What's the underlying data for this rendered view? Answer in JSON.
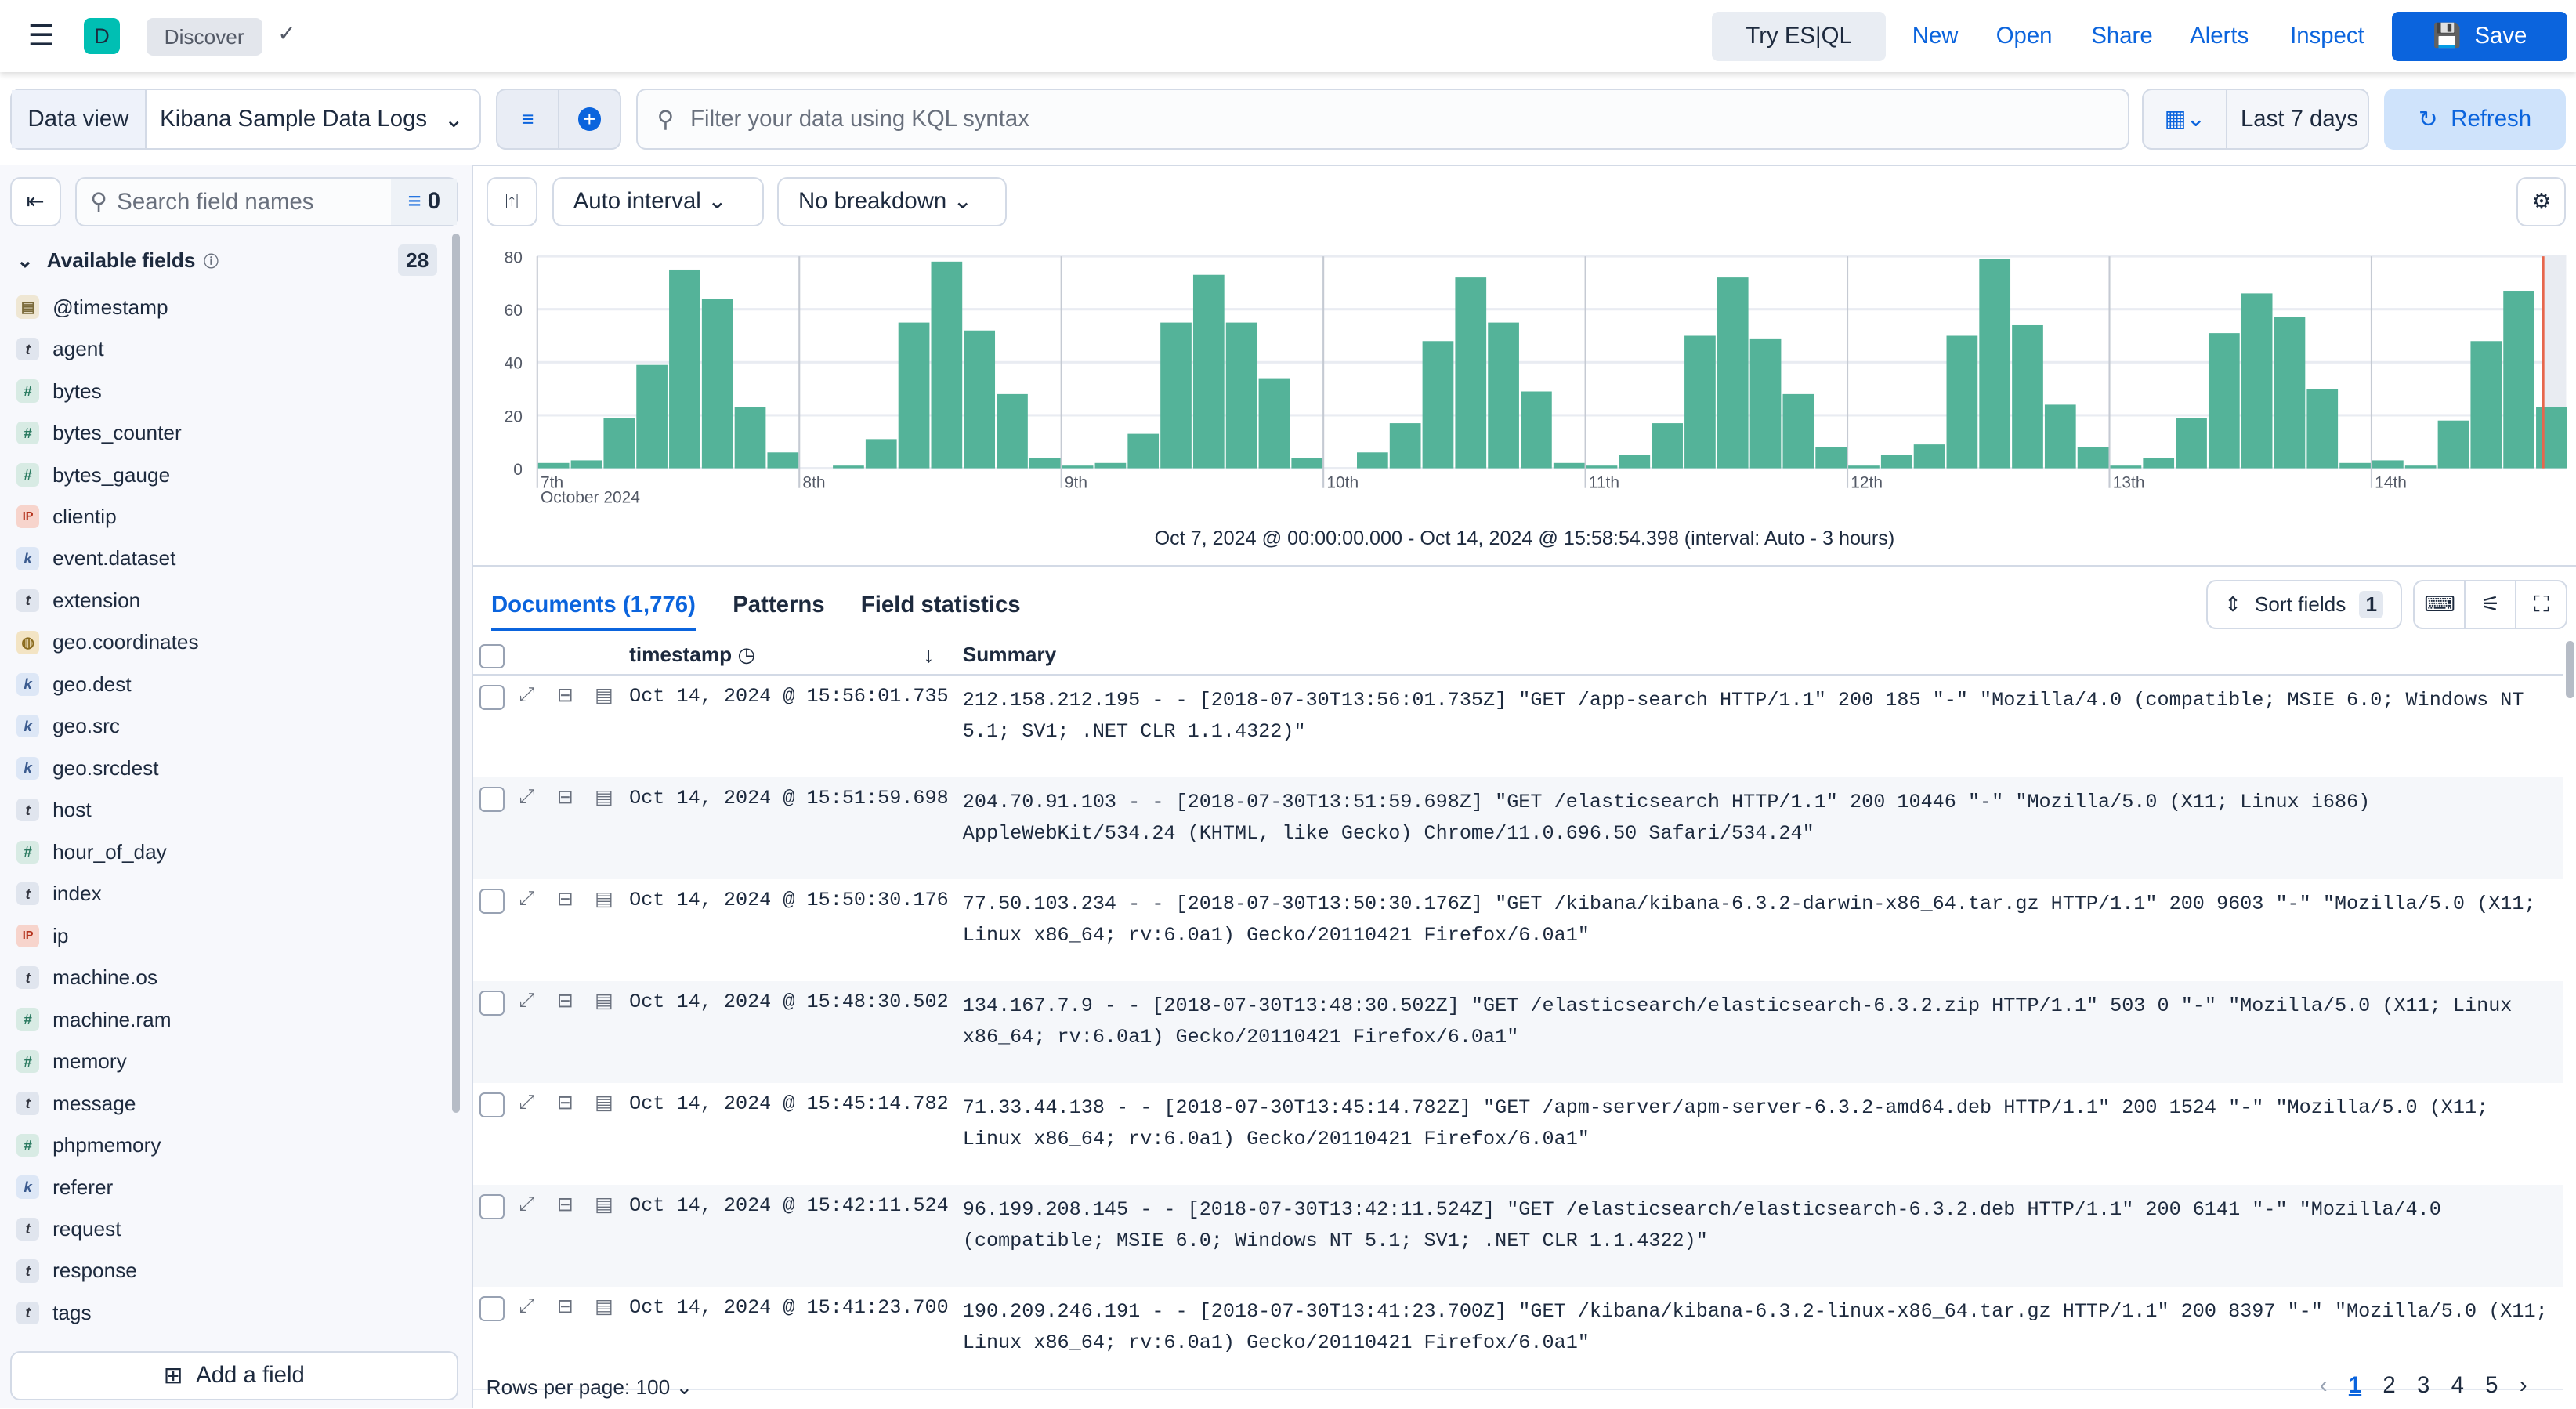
{
  "header": {
    "app_initial": "D",
    "breadcrumb": "Discover",
    "links": [
      "Try ES|QL",
      "New",
      "Open",
      "Share",
      "Alerts",
      "Inspect"
    ],
    "save": "Save",
    "accent": "#0b64dd",
    "app_color": "#00bfb3"
  },
  "query": {
    "data_view_label": "Data view",
    "data_view": "Kibana Sample Data Logs",
    "placeholder": "Filter your data using KQL syntax",
    "time": "Last 7 days",
    "refresh": "Refresh"
  },
  "sidebar": {
    "search_placeholder": "Search field names",
    "filter_count": "0",
    "available_label": "Available fields",
    "available_count": "28",
    "add_field": "Add a field",
    "fields": [
      {
        "name": "@timestamp",
        "type": "date"
      },
      {
        "name": "agent",
        "type": "t"
      },
      {
        "name": "bytes",
        "type": "#"
      },
      {
        "name": "bytes_counter",
        "type": "#"
      },
      {
        "name": "bytes_gauge",
        "type": "#"
      },
      {
        "name": "clientip",
        "type": "IP"
      },
      {
        "name": "event.dataset",
        "type": "k"
      },
      {
        "name": "extension",
        "type": "t"
      },
      {
        "name": "geo.coordinates",
        "type": "geo"
      },
      {
        "name": "geo.dest",
        "type": "k"
      },
      {
        "name": "geo.src",
        "type": "k"
      },
      {
        "name": "geo.srcdest",
        "type": "k"
      },
      {
        "name": "host",
        "type": "t"
      },
      {
        "name": "hour_of_day",
        "type": "#"
      },
      {
        "name": "index",
        "type": "t"
      },
      {
        "name": "ip",
        "type": "IP"
      },
      {
        "name": "machine.os",
        "type": "t"
      },
      {
        "name": "machine.ram",
        "type": "#"
      },
      {
        "name": "memory",
        "type": "#"
      },
      {
        "name": "message",
        "type": "t"
      },
      {
        "name": "phpmemory",
        "type": "#"
      },
      {
        "name": "referer",
        "type": "k"
      },
      {
        "name": "request",
        "type": "t"
      },
      {
        "name": "response",
        "type": "t"
      },
      {
        "name": "tags",
        "type": "t"
      }
    ]
  },
  "chart_toolbar": {
    "interval": "Auto interval",
    "breakdown": "No breakdown"
  },
  "chart_data": {
    "type": "bar",
    "ylim": [
      0,
      80
    ],
    "yticks": [
      "0",
      "20",
      "40",
      "60",
      "80"
    ],
    "xticks": [
      "7th",
      "8th",
      "9th",
      "10th",
      "11th",
      "12th",
      "13th",
      "14th"
    ],
    "x_sublabel": "October 2024",
    "bar_color": "#54b399",
    "now_color": "#e7664c",
    "grid": true,
    "values": [
      2,
      3,
      19,
      39,
      75,
      64,
      23,
      6,
      0,
      1,
      11,
      55,
      78,
      52,
      28,
      4,
      1,
      2,
      13,
      55,
      73,
      55,
      34,
      4,
      0,
      6,
      17,
      48,
      72,
      55,
      29,
      2,
      1,
      5,
      17,
      50,
      72,
      49,
      28,
      8,
      1,
      5,
      9,
      50,
      79,
      54,
      24,
      8,
      1,
      4,
      19,
      51,
      66,
      57,
      30,
      2,
      3,
      1,
      18,
      48,
      67,
      23
    ],
    "caption": "Oct 7, 2024 @ 00:00:00.000 - Oct 14, 2024 @ 15:58:54.398 (interval: Auto - 3 hours)"
  },
  "tabs": [
    "Documents (1,776)",
    "Patterns",
    "Field statistics"
  ],
  "table": {
    "sort_fields": "Sort fields",
    "sort_count": "1",
    "col_timestamp": "timestamp",
    "col_summary": "Summary",
    "rows": [
      {
        "ts": "Oct 14, 2024 @ 15:56:01.735",
        "summary": "212.158.212.195 - - [2018-07-30T13:56:01.735Z] \"GET /app-search HTTP/1.1\" 200 185 \"-\" \"Mozilla/4.0 (compatible; MSIE 6.0; Windows NT 5.1; SV1; .NET CLR 1.1.4322)\""
      },
      {
        "ts": "Oct 14, 2024 @ 15:51:59.698",
        "summary": "204.70.91.103 - - [2018-07-30T13:51:59.698Z] \"GET /elasticsearch HTTP/1.1\" 200 10446 \"-\" \"Mozilla/5.0 (X11; Linux i686) AppleWebKit/534.24 (KHTML, like Gecko) Chrome/11.0.696.50 Safari/534.24\""
      },
      {
        "ts": "Oct 14, 2024 @ 15:50:30.176",
        "summary": "77.50.103.234 - - [2018-07-30T13:50:30.176Z] \"GET /kibana/kibana-6.3.2-darwin-x86_64.tar.gz HTTP/1.1\" 200 9603 \"-\" \"Mozilla/5.0 (X11; Linux x86_64; rv:6.0a1) Gecko/20110421 Firefox/6.0a1\""
      },
      {
        "ts": "Oct 14, 2024 @ 15:48:30.502",
        "summary": "134.167.7.9 - - [2018-07-30T13:48:30.502Z] \"GET /elasticsearch/elasticsearch-6.3.2.zip HTTP/1.1\" 503 0 \"-\" \"Mozilla/5.0 (X11; Linux x86_64; rv:6.0a1) Gecko/20110421 Firefox/6.0a1\""
      },
      {
        "ts": "Oct 14, 2024 @ 15:45:14.782",
        "summary": "71.33.44.138 - - [2018-07-30T13:45:14.782Z] \"GET /apm-server/apm-server-6.3.2-amd64.deb HTTP/1.1\" 200 1524 \"-\" \"Mozilla/5.0 (X11; Linux x86_64; rv:6.0a1) Gecko/20110421 Firefox/6.0a1\""
      },
      {
        "ts": "Oct 14, 2024 @ 15:42:11.524",
        "summary": "96.199.208.145 - - [2018-07-30T13:42:11.524Z] \"GET /elasticsearch/elasticsearch-6.3.2.deb HTTP/1.1\" 200 6141 \"-\" \"Mozilla/4.0 (compatible; MSIE 6.0; Windows NT 5.1; SV1; .NET CLR 1.1.4322)\""
      },
      {
        "ts": "Oct 14, 2024 @ 15:41:23.700",
        "summary": "190.209.246.191 - - [2018-07-30T13:41:23.700Z] \"GET /kibana/kibana-6.3.2-linux-x86_64.tar.gz HTTP/1.1\" 200 8397 \"-\" \"Mozilla/5.0 (X11; Linux x86_64; rv:6.0a1) Gecko/20110421 Firefox/6.0a1\""
      }
    ]
  },
  "footer": {
    "rows_per_page": "Rows per page: 100",
    "pages": [
      "1",
      "2",
      "3",
      "4",
      "5"
    ],
    "current_page": "1"
  }
}
